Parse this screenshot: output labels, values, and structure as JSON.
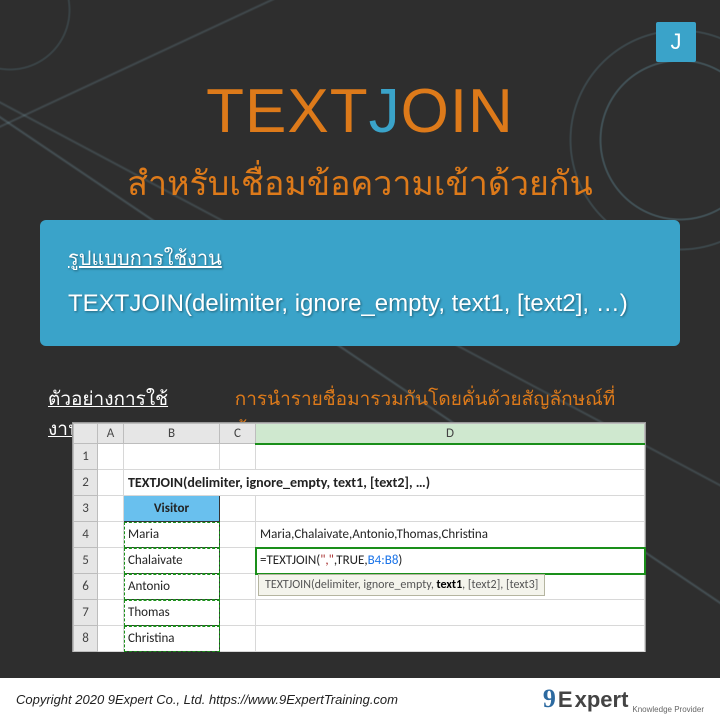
{
  "badge": "J",
  "title": {
    "part1": "TEXT",
    "part2": "J",
    "part3": "OIN"
  },
  "subtitle": "สำหรับเชื่อมข้อความเข้าด้วยกัน",
  "syntax": {
    "label": "รูปแบบการใช้งาน",
    "text": "TEXTJOIN(delimiter, ignore_empty, text1, [text2], …)"
  },
  "example": {
    "label": "ตัวอย่างการใช้งาน",
    "desc": "การนำรายชื่อมารวมกันโดยคั่นด้วยสัญลักษณ์ที่ต้องการ"
  },
  "excel": {
    "columns": [
      "A",
      "B",
      "C",
      "D"
    ],
    "rows": [
      "1",
      "2",
      "3",
      "4",
      "5",
      "6",
      "7",
      "8"
    ],
    "row2_title": "TEXTJOIN(delimiter, ignore_empty, text1, [text2], …)",
    "visitor_header": "Visitor",
    "visitors": [
      "Maria",
      "Chalaivate",
      "Antonio",
      "Thomas",
      "Christina"
    ],
    "result": "Maria,Chalaivate,Antonio,Thomas,Christina",
    "formula_prefix": "=TEXTJOIN(",
    "formula_lit": "\",\"",
    "formula_mid": ",TRUE,",
    "formula_ref": "B4:B8",
    "formula_suffix": ")",
    "tooltip_pre": "TEXTJOIN(delimiter, ignore_empty, ",
    "tooltip_bold": "text1",
    "tooltip_post": ", [text2], [text3]"
  },
  "footer": {
    "copyright": "Copyright 2020 9Expert Co., Ltd.   https://www.9ExpertTraining.com",
    "logo_9": "9",
    "logo_e": "E",
    "logo_xpert": "xpert",
    "logo_tag": "Knowledge Provider"
  }
}
